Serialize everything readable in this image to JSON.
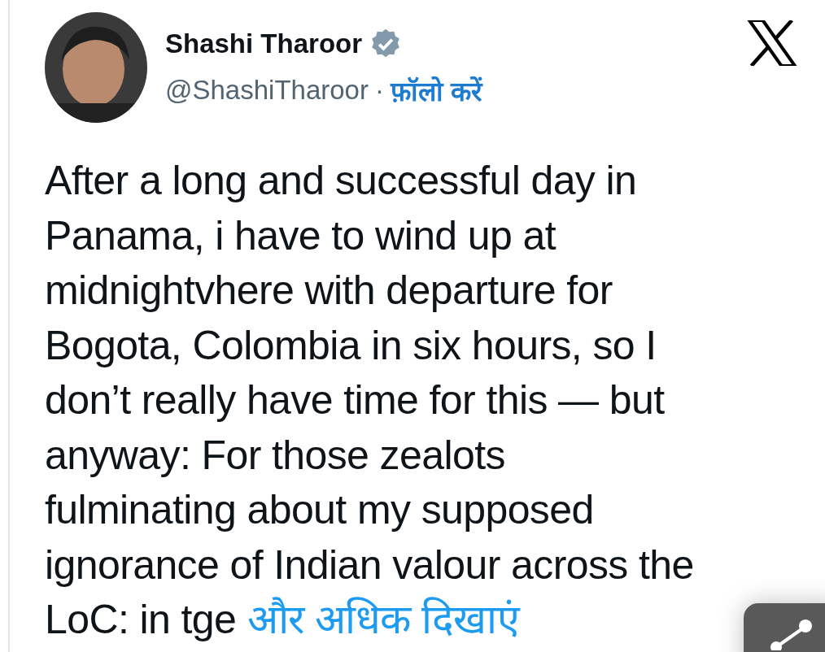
{
  "author": {
    "name": "Shashi Tharoor",
    "verified": true,
    "handle": "@ShashiTharoor",
    "separator": "·",
    "follow": "फ़ॉलो करें"
  },
  "body": {
    "text": "After a long and successful day in\nPanama, i have to wind up at\nmidnightvhere with departure for\nBogota, Colombia in six hours, so I\ndon’t really have time for this — but\nanyway: For those zealots\nfulminating about my supposed\nignorance of Indian valour across the\nLoC: in tge ",
    "show_more": "और अधिक दिखाएं"
  }
}
